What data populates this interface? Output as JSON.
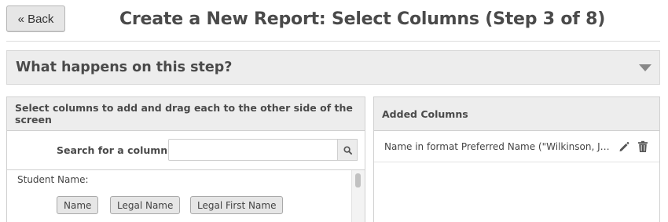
{
  "header": {
    "back_label": "« Back",
    "title": "Create a New Report: Select Columns (Step 3 of 8)"
  },
  "accordion": {
    "title": "What happens on this step?",
    "icon": "chevron-down-icon"
  },
  "left_panel": {
    "header": "Select columns to add and drag each to the other side of the screen",
    "search": {
      "label": "Search for a column:",
      "value": "",
      "placeholder": "",
      "icon": "search-icon"
    },
    "groups": [
      {
        "label": "Student Name:",
        "items": [
          "Name",
          "Legal Name",
          "Legal First Name"
        ]
      }
    ]
  },
  "right_panel": {
    "header": "Added Columns",
    "items": [
      {
        "label": "Name in format Preferred Name (\"Wilkinson, Jonn…",
        "icons": [
          "pencil-icon",
          "trash-icon"
        ]
      }
    ]
  },
  "colors": {
    "header_bg": "#ededed",
    "chip_bg": "#e6e6e6",
    "border": "#d0d0d0",
    "text": "#4a4a4a"
  }
}
